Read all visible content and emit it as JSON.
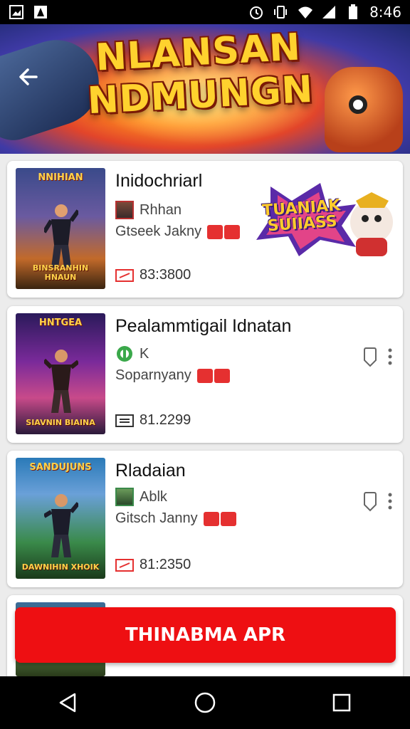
{
  "status_bar": {
    "time": "8:46"
  },
  "banner": {
    "title_line1": "NLANSAN",
    "title_line2": "NDMUNGN"
  },
  "cards": [
    {
      "title": "Inidochriarl",
      "poster_title": "NNIHIAN",
      "poster_bottom": "BINSRANHIN HNAUN",
      "author": "Rhhan",
      "subtitle": "Gtseek Jakny",
      "price": "83:3800",
      "ad_text": "TUANIAK SUIIASS"
    },
    {
      "title": "Pealammtigail Idnatan",
      "poster_title": "HNTGEA",
      "poster_bottom": "SIAVNIN BIAINA",
      "author": "K",
      "subtitle": "Soparnyany",
      "price": "81.2299"
    },
    {
      "title": "Rladaian",
      "poster_title": "SANDUJUNS",
      "poster_bottom": "DAWNIHIN XHOIK",
      "author": "Ablk",
      "subtitle": "Gitsch Janny",
      "price": "81:2350"
    }
  ],
  "cta": {
    "label": "THINABMA APR"
  },
  "colors": {
    "accent": "#ee0f12",
    "card_bg": "#ffffff",
    "page_bg": "#ececec"
  }
}
